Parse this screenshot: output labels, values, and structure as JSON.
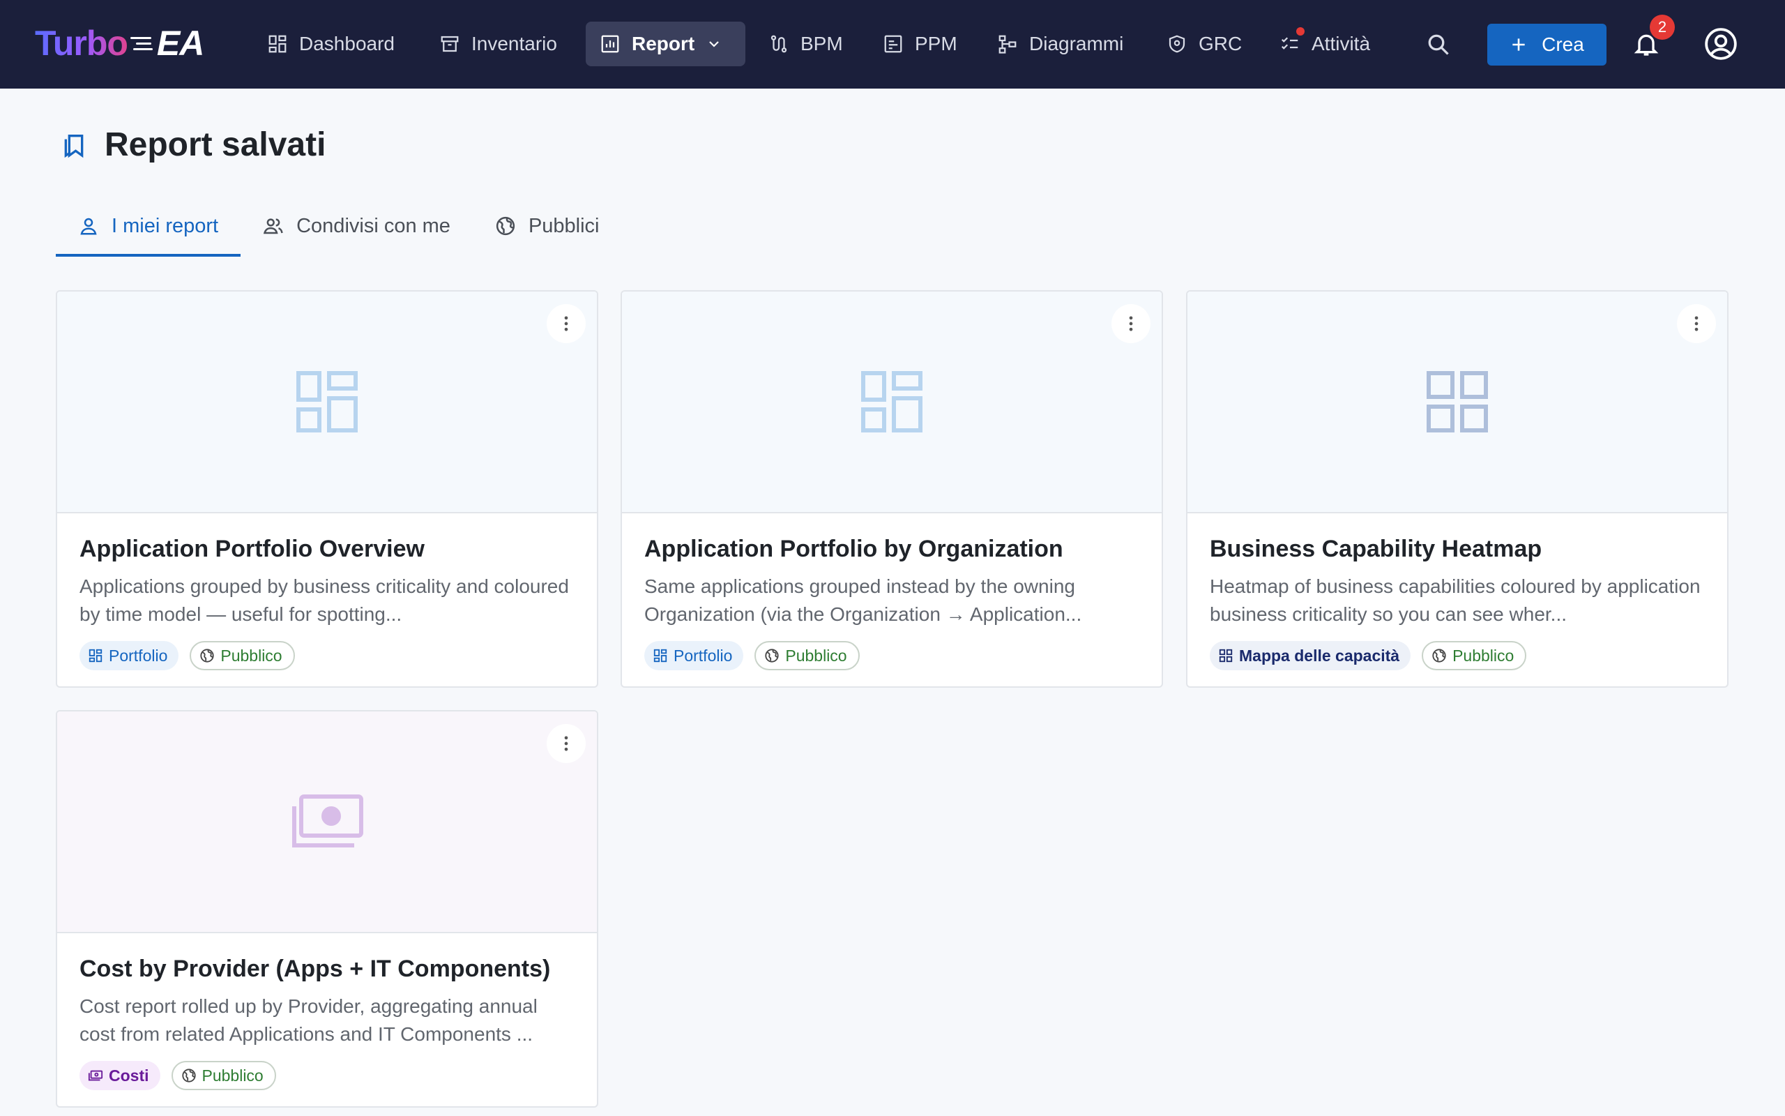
{
  "app": {
    "logo_text": "Turbo",
    "logo_suffix": "EA"
  },
  "nav": {
    "dashboard": "Dashboard",
    "inventory": "Inventario",
    "report": "Report",
    "bpm": "BPM",
    "ppm": "PPM",
    "diagrams": "Diagrammi",
    "grc": "GRC",
    "activities": "Attività"
  },
  "header": {
    "create_label": "Crea",
    "notifications_count": "2"
  },
  "page": {
    "title": "Report salvati"
  },
  "tabs": {
    "mine": "I miei report",
    "shared": "Condivisi con me",
    "public": "Pubblici"
  },
  "cards": [
    {
      "title": "Application Portfolio Overview",
      "description": "Applications grouped by business criticality and coloured by time model — useful for spotting...",
      "type_label": "Portfolio",
      "visibility": "Pubblico"
    },
    {
      "title": "Application Portfolio by Organization",
      "description": "Same applications grouped instead by the owning Organization (via the Organization → Application...",
      "type_label": "Portfolio",
      "visibility": "Pubblico"
    },
    {
      "title": "Business Capability Heatmap",
      "description": "Heatmap of business capabilities coloured by application business criticality so you can see wher...",
      "type_label": "Mappa delle capacità",
      "visibility": "Pubblico"
    },
    {
      "title": "Cost by Provider (Apps + IT Components)",
      "description": "Cost report rolled up by Provider, aggregating annual cost from related Applications and IT Components ...",
      "type_label": "Costi",
      "visibility": "Pubblico"
    }
  ],
  "colors": {
    "topbar": "#1b1f3b",
    "accent": "#1565c0",
    "public_green": "#2e7d32",
    "cost_purple": "#6a1b9a",
    "badge_red": "#e53935"
  }
}
